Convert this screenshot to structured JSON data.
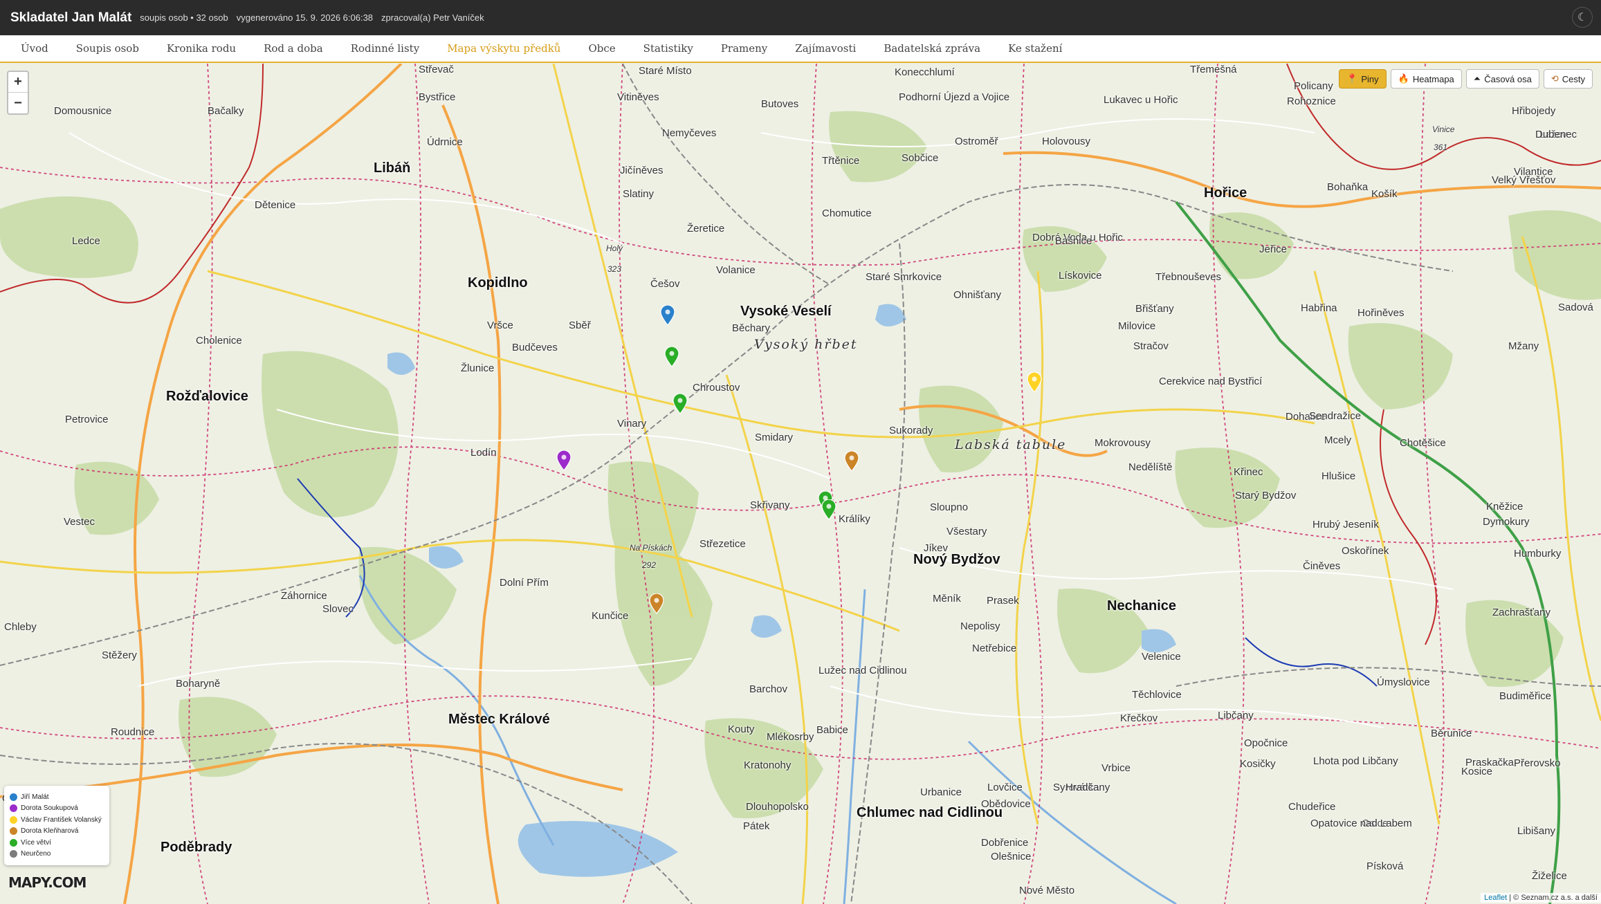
{
  "header": {
    "title": "Skladatel Jan Malát",
    "count": "soupis osob • 32 osob",
    "generated": "vygenerováno 15. 9. 2026 6:06:38",
    "author": "zpracoval(a) Petr Vaníček",
    "theme_icon": "☾"
  },
  "nav": {
    "items": [
      "Úvod",
      "Soupis osob",
      "Kronika rodu",
      "Rod a doba",
      "Rodinné listy",
      "Mapa výskytu předků",
      "Obce",
      "Statistiky",
      "Prameny",
      "Zajímavosti",
      "Badatelská zpráva",
      "Ke stažení"
    ],
    "active": "Mapa výskytu předků"
  },
  "map_controls": {
    "zoom_in": "+",
    "zoom_out": "−",
    "layers": [
      {
        "label": "Piny",
        "icon": "pin-icon",
        "active": true
      },
      {
        "label": "Heatmapa",
        "icon": "flame-icon",
        "active": false
      },
      {
        "label": "Časová osa",
        "icon": "timeline-icon",
        "active": false
      },
      {
        "label": "Cesty",
        "icon": "route-icon",
        "active": false
      }
    ]
  },
  "legend": [
    {
      "label": "Jiří Malát",
      "color": "#2a81cb"
    },
    {
      "label": "Dorota Soukupová",
      "color": "#9c2bcb"
    },
    {
      "label": "Václav František Volanský",
      "color": "#ffd326"
    },
    {
      "label": "Dorota Kleňharová",
      "color": "#cb8427"
    },
    {
      "label": "Více větví",
      "color": "#2aad27"
    },
    {
      "label": "Neurčeno",
      "color": "#7b7b7b"
    }
  ],
  "pins": [
    {
      "person": "Jiří Malát",
      "color": "#2a81cb"
    },
    {
      "person": "Více větví",
      "color": "#2aad27"
    },
    {
      "person": "Více větví",
      "color": "#2aad27"
    },
    {
      "person": "Dorota Soukupová",
      "color": "#9c2bcb"
    },
    {
      "person": "Dorota Kleňharová",
      "color": "#cb8427"
    },
    {
      "person": "Více větví",
      "color": "#2aad27"
    },
    {
      "person": "Více větví",
      "color": "#2aad27"
    },
    {
      "person": "Dorota Kleňharová",
      "color": "#cb8427"
    },
    {
      "person": "Václav František Volanský",
      "color": "#ffd326"
    }
  ],
  "places": {
    "big": [
      "Libáň",
      "Kopidlno",
      "Rožďalovice",
      "Vysoké Veselí",
      "Hořice",
      "Nový Bydžov",
      "Nechanice",
      "Městec Králové",
      "Poděbrady",
      "Chlumec nad Cidlinou"
    ],
    "small": [
      "Střevač",
      "Staré Místo",
      "Vitiněves",
      "Butoves",
      "Konecchlumí",
      "Podhorní Újezd a Vojice",
      "Ostroměř",
      "Holovousy",
      "Lukavec u Hořic",
      "Třemešná",
      "Rohoznice",
      "Policany",
      "Hřibojedy",
      "Domousnice",
      "Bačalky",
      "Bystřice",
      "Údrnice",
      "Nemyčeves",
      "Jičíněves",
      "Slatiny",
      "Třtěnice",
      "Sobčice",
      "Žeretice",
      "Chomutice",
      "Dětenice",
      "Ledce",
      "Češov",
      "Volanice",
      "Staré Smrkovice",
      "Ohnišťany",
      "Dobrá Voda u Hořic",
      "Bašnice",
      "Lískovice",
      "Třebnouševes",
      "Jeřice",
      "Bohaňka",
      "Lažov",
      "Dubenec",
      "Vilantice",
      "Velký Vřešťov",
      "Košík",
      "Cholenice",
      "Vršce",
      "Sběř",
      "Běchary",
      "Budčeves",
      "Žlunice",
      "Chroustov",
      "Vinary",
      "Smidary",
      "Sukorady",
      "Milovice",
      "Břišťany",
      "Stračov",
      "Cerekvice nad Bystřicí",
      "Habřina",
      "Hořiněves",
      "Mžany",
      "Sadová",
      "Dohalice",
      "Sendražice",
      "Mcely",
      "Chotěšice",
      "Petrovice",
      "Lodín",
      "Mokrovousy",
      "Nedělíště",
      "Křinec",
      "Hlušice",
      "Starý Bydžov",
      "Skřivany",
      "Králíky",
      "Sloupno",
      "Všestary",
      "Jíkev",
      "Kněžice",
      "Střezetice",
      "Hrubý Jeseník",
      "Dymokury",
      "Vestec",
      "Záhornice",
      "Prasek",
      "Dolní Přím",
      "Oskořínek",
      "Činěves",
      "Humburky",
      "Chleby",
      "Slovec",
      "Měník",
      "Kunčice",
      "Nepolisy",
      "Netřebice",
      "Velenice",
      "Zachrašťany",
      "Stěžery",
      "Lužec nad Cidlinou",
      "Boharyně",
      "Těchlovice",
      "Úmyslovice",
      "Barchov",
      "Budiměřice",
      "Babice",
      "Libčany",
      "Křečkov",
      "Kouty",
      "Vrbice",
      "Běrunice",
      "Mlékosrby",
      "Roudnice",
      "Urbanice",
      "Opočnice",
      "Kosice",
      "Kosičky",
      "Kratonohy",
      "Lhota pod Libčany",
      "Pátek",
      "Dlouhopolsko",
      "Praskačka",
      "Lovčice",
      "Obědovice",
      "Syrovátka",
      "Hradčany",
      "Přerovsko",
      "Dobřenice",
      "Libišany",
      "Odřepsy",
      "Olešnice",
      "Nové Město",
      "Chudeřice",
      "Osice",
      "Opatovice nad Labem",
      "Písková",
      "Žiželice"
    ]
  },
  "region_labels": [
    "Vysoký hřbet",
    "Labská tabule"
  ],
  "hill_labels": [
    "Holý",
    "323",
    "Na Pískách",
    "292",
    "Vinice",
    "361"
  ],
  "attribution": {
    "leaflet": "Leaflet",
    "rest": "| © Seznam.cz a.s. a další"
  },
  "logo": "MAPY.COM"
}
